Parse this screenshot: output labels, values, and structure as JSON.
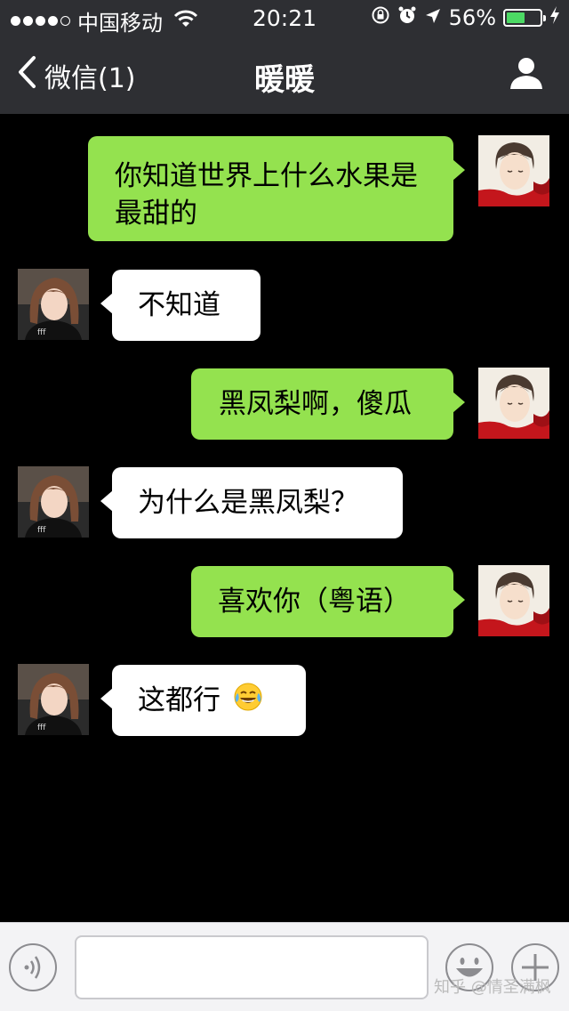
{
  "status_bar": {
    "carrier": "中国移动",
    "time": "20:21",
    "battery_percent": "56%",
    "battery_level": 0.56,
    "signal_bars_filled": 4,
    "signal_bars_total": 5
  },
  "nav": {
    "back_label": "微信(1)",
    "title": "暖暖"
  },
  "messages": [
    {
      "side": "right",
      "lines": [
        "你知道世界上什么水果是",
        "最甜的"
      ]
    },
    {
      "side": "left",
      "text": "不知道"
    },
    {
      "side": "right",
      "text": "黑凤梨啊，傻瓜"
    },
    {
      "side": "left",
      "text": "为什么是黑凤梨？"
    },
    {
      "side": "right",
      "text": "喜欢你（粤语）"
    },
    {
      "side": "left",
      "text": "这都行",
      "emoji": "tears-of-joy-emoji"
    }
  ],
  "input": {
    "value": "",
    "placeholder": ""
  },
  "watermark": "知乎 @情圣满枫",
  "colors": {
    "header_bg": "#2e2f33",
    "chat_bg": "#000000",
    "sent_bubble": "#94e24f",
    "received_bubble": "#ffffff",
    "battery_fill": "#4cd964"
  }
}
